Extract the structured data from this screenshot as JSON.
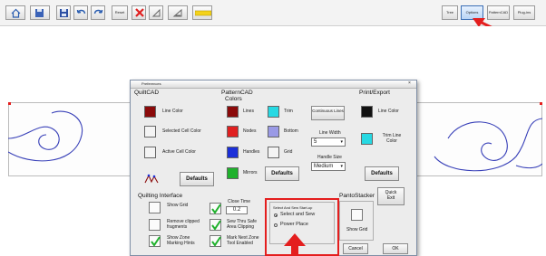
{
  "toolbar": {
    "buttons": [
      {
        "label": "",
        "icon": "home-icon"
      },
      {
        "label": "",
        "icon": "save-as-icon"
      },
      {
        "label": "",
        "icon": "save-icon"
      },
      {
        "label": "",
        "icon": "undo-icon"
      },
      {
        "label": "",
        "icon": "redo-icon"
      },
      {
        "label": "Reset",
        "icon": "reset-icon"
      },
      {
        "label": "",
        "icon": "delete-icon"
      },
      {
        "label": "",
        "icon": "zoom-icon"
      },
      {
        "label": "",
        "icon": "zoom-out-icon"
      },
      {
        "label": "",
        "icon": "highlight-tool-icon"
      }
    ],
    "right_buttons": [
      "Tree",
      "Options",
      "PatternCAD",
      "Plug-ins"
    ]
  },
  "dialog": {
    "title": "Preferences",
    "quiltcad": {
      "header": "QuiltCAD",
      "line_color_label": "Line Color",
      "selected_cell_color_label": "Selected Cell Color",
      "active_cell_color_label": "Active Cell Color",
      "defaults_label": "Defaults"
    },
    "patterncad": {
      "header": "PatternCAD",
      "colors_header": "Colors",
      "lines_label": "Lines",
      "trim_label": "Trim",
      "nodes_label": "Nodes",
      "bottom_label": "Bottom",
      "handles_label": "Handles",
      "grid_label": "Grid",
      "mirrors_label": "Mirrors",
      "defaults_label": "Defaults",
      "continuous_lines_label": "Continuous Lines",
      "line_width_label": "Line Width",
      "line_width_value": "5",
      "handle_size_label": "Handle Size",
      "handle_size_value": "Medium"
    },
    "printexport": {
      "header": "Print/Export",
      "line_color_label": "Line Color",
      "trim_line_color_label": "Trim Line Color",
      "defaults_label": "Defaults"
    },
    "quilting_interface": {
      "header": "Quilting Interface",
      "show_grid_label": "Show Grid",
      "remove_clipped_label": "Remove clipped fragments",
      "show_zone_marking_label": "Show Zone Marking Hints",
      "close_time_label": "Close Time",
      "close_time_value": "0.2",
      "sew_thru_safe_label": "Sew Thru Safe Area Clipping",
      "mark_next_zone_label": "Mark Next Zone Tool Enabled"
    },
    "sew_start": {
      "header": "Select And Sew Start-up",
      "option_select_and_sew": "Select and Sew",
      "option_power_place": "Power Place",
      "selected": "Select and Sew"
    },
    "pantostacker": {
      "header": "PantoStacker",
      "show_grid_label": "Show Grid"
    },
    "quick_exit_label": "Quick Exit",
    "cancel_label": "Cancel",
    "ok_label": "OK"
  },
  "colors": {
    "dark_red": "#8b0a0a",
    "red": "#e02020",
    "cyan": "#27d9e3",
    "blue": "#1b2fd8",
    "lavender": "#9a9ae6",
    "green": "#1fb12c",
    "black": "#111111",
    "annotation_red": "#e41e1e",
    "spiral_blue": "#3840b8"
  }
}
